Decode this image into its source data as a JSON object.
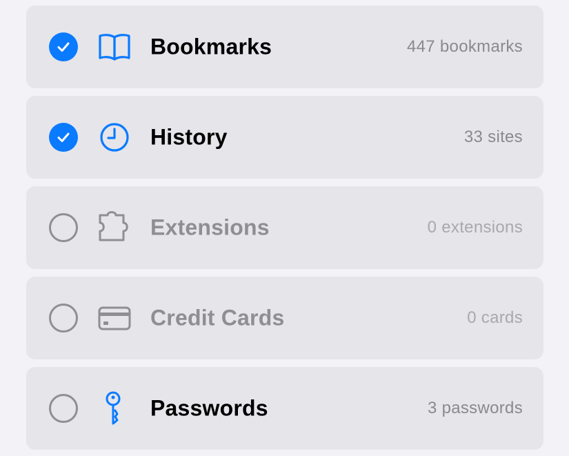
{
  "colors": {
    "accent": "#0a7aff",
    "row_background": "#e5e5ea",
    "page_background": "#f2f2f7",
    "disabled_text": "#8e8e93",
    "detail_text": "#8a8a8e"
  },
  "items": [
    {
      "label": "Bookmarks",
      "count": "447 bookmarks",
      "checked": true,
      "enabled": true,
      "icon": "book-icon"
    },
    {
      "label": "History",
      "count": "33 sites",
      "checked": true,
      "enabled": true,
      "icon": "clock-icon"
    },
    {
      "label": "Extensions",
      "count": "0 extensions",
      "checked": false,
      "enabled": false,
      "icon": "puzzle-piece-icon"
    },
    {
      "label": "Credit Cards",
      "count": "0 cards",
      "checked": false,
      "enabled": false,
      "icon": "credit-card-icon"
    },
    {
      "label": "Passwords",
      "count": "3 passwords",
      "checked": false,
      "enabled": true,
      "icon": "key-icon"
    }
  ]
}
